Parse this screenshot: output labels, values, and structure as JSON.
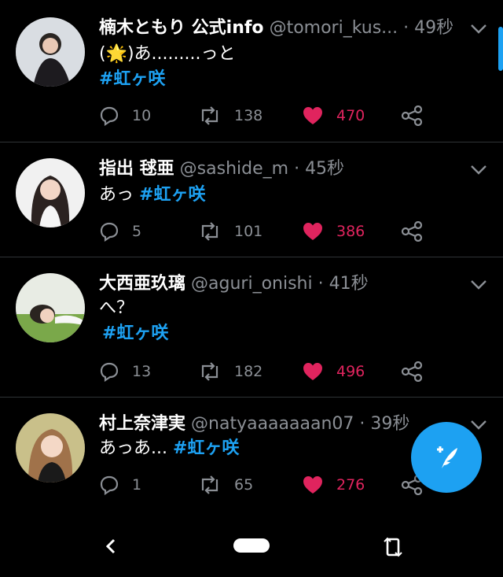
{
  "colors": {
    "accent": "#1da1f2",
    "like": "#e0245e",
    "muted": "#8b8f95",
    "background": "#000000"
  },
  "tweets": [
    {
      "name": "楠木ともり 公式info",
      "handle": "@tomori_kus...",
      "time": "· 49秒",
      "line1": "(🌟)あ.........っと",
      "hashtag": "#虹ヶ咲",
      "reply_count": "10",
      "retweet_count": "138",
      "like_count": "470",
      "avatar": "profile-photo-dark-hair-sitting"
    },
    {
      "name": "指出 毬亜",
      "handle": "@sashide_m",
      "time": "· 45秒",
      "line1": "あっ",
      "hashtag": "#虹ヶ咲",
      "reply_count": "5",
      "retweet_count": "101",
      "like_count": "386",
      "avatar": "profile-photo-long-dark-hair"
    },
    {
      "name": "大西亜玖璃",
      "handle": "@aguri_onishi",
      "time": "· 41秒",
      "line1": "へ？",
      "hashtag": "#虹ヶ咲",
      "reply_count": "13",
      "retweet_count": "182",
      "like_count": "496",
      "avatar": "profile-photo-lying-on-grass"
    },
    {
      "name": "村上奈津実",
      "handle": "@natyaaaaaaan07",
      "time": "· 39秒",
      "line1": "あっあ...",
      "hashtag": "#虹ヶ咲",
      "reply_count": "1",
      "retweet_count": "65",
      "like_count": "276",
      "avatar": "profile-photo-smiling-outdoors"
    }
  ],
  "fab": {
    "icon": "compose-tweet-icon"
  },
  "system_nav": {
    "back_icon": "back-icon",
    "home_icon": "home-pill",
    "rotate_icon": "rotate-icon"
  }
}
